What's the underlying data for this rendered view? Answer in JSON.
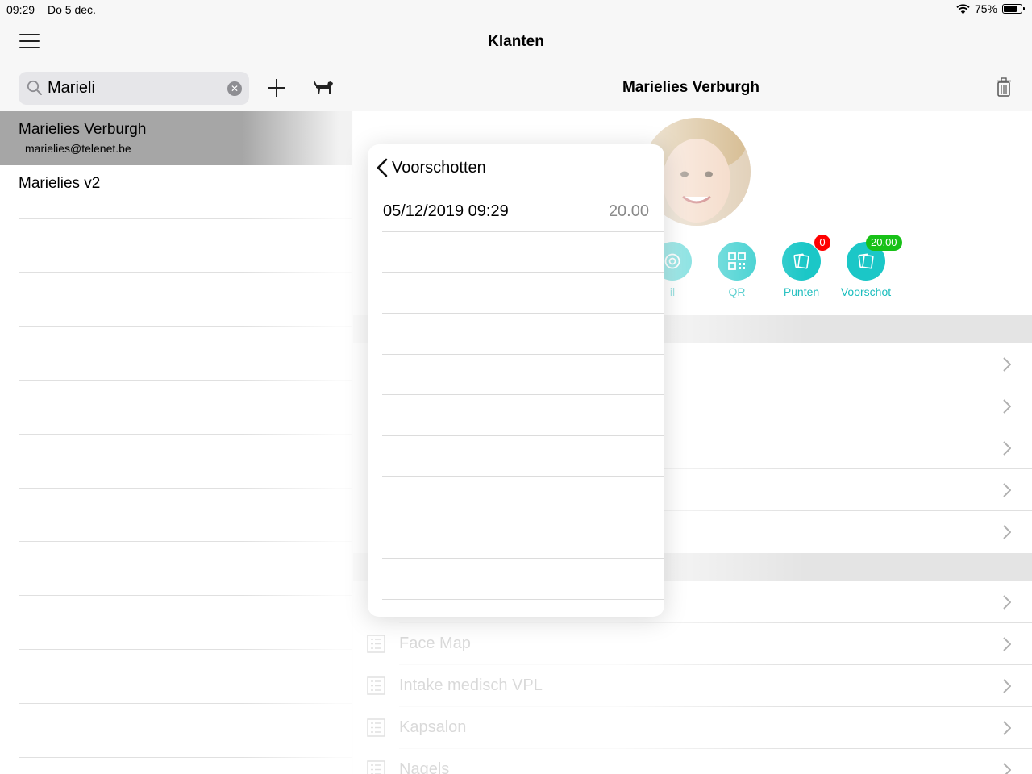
{
  "status": {
    "time": "09:29",
    "date": "Do 5 dec.",
    "battery_pct": "75%",
    "battery_level": 0.75
  },
  "nav": {
    "title": "Klanten"
  },
  "search": {
    "value": "Marieli",
    "placeholder": ""
  },
  "clients": [
    {
      "name": "Marielies Verburgh",
      "email": "marielies@telenet.be",
      "selected": true
    },
    {
      "name": "Marielies v2",
      "email": "",
      "selected": false
    }
  ],
  "detail": {
    "title": "Marielies Verburgh",
    "actions": [
      {
        "label": "il",
        "badge": ""
      },
      {
        "label": "QR",
        "badge": ""
      },
      {
        "label": "Punten",
        "badge": "0"
      },
      {
        "label": "Voorschot",
        "badge": "20.00"
      }
    ],
    "forms": [
      {
        "label": "Face Map"
      },
      {
        "label": "Intake medisch VPL"
      },
      {
        "label": "Kapsalon"
      },
      {
        "label": "Nagels"
      }
    ]
  },
  "popover": {
    "title": "Voorschotten",
    "items": [
      {
        "date": "05/12/2019 09:29",
        "amount": "20.00"
      }
    ]
  },
  "colors": {
    "accent": "#1bc7c7",
    "badge_red": "#ff0000",
    "badge_green": "#18c118",
    "selected_row": "#a6a6a6"
  }
}
